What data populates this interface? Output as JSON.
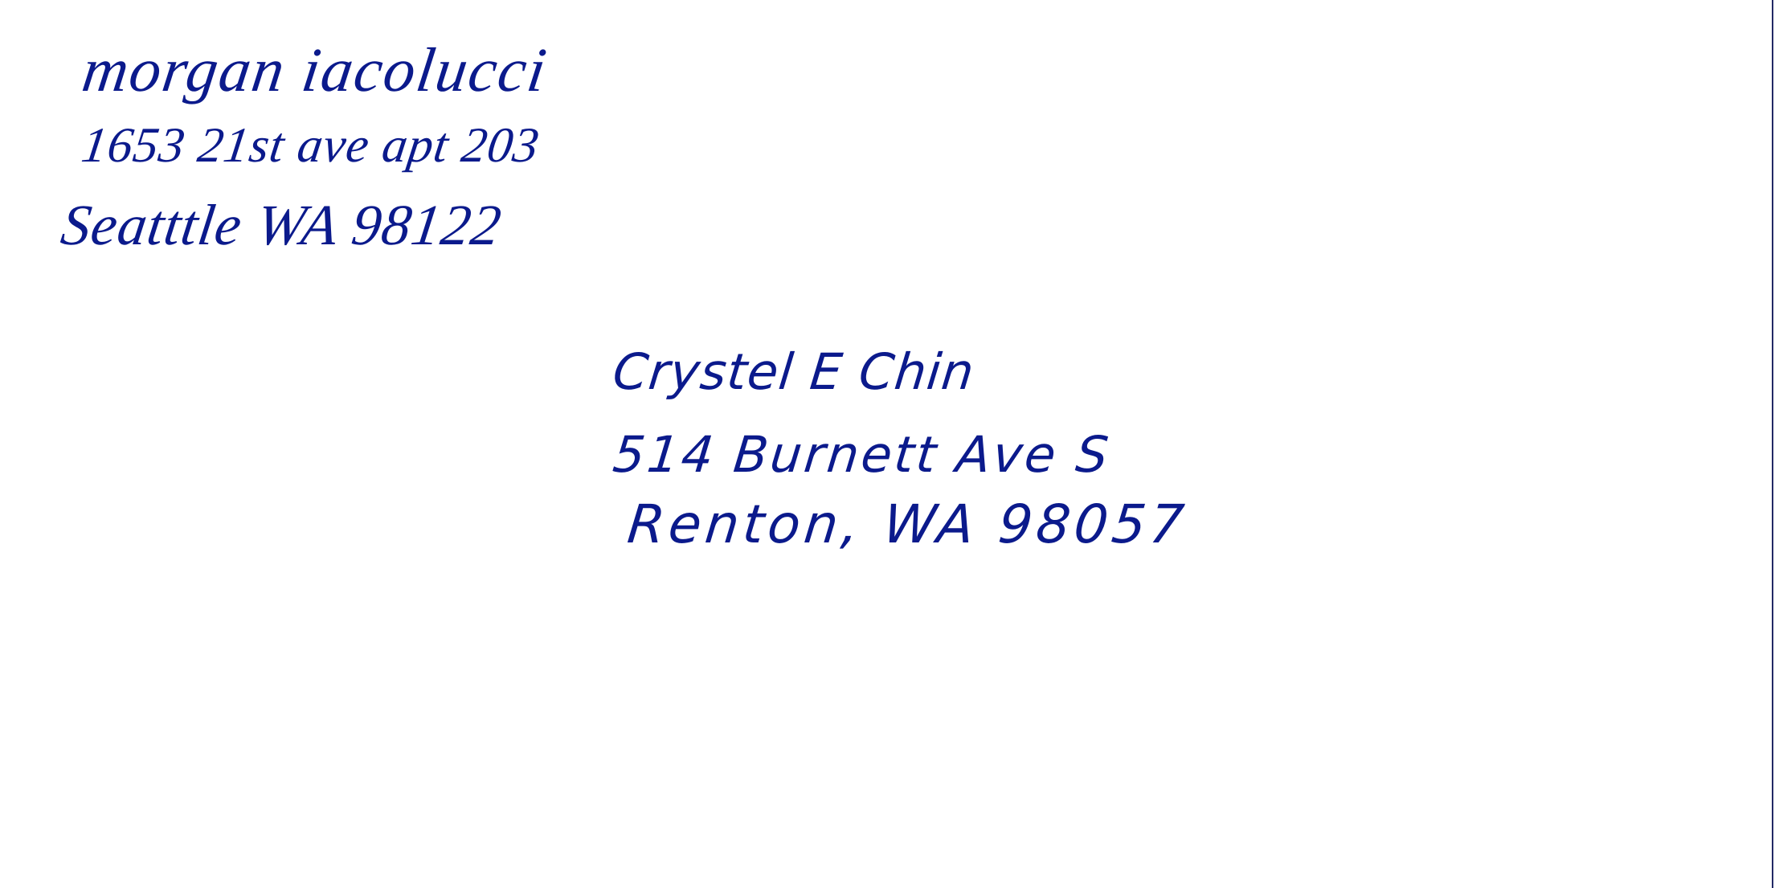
{
  "ink_color": "#0b1a8c",
  "return_address": {
    "name": "morgan iacolucci",
    "street": "1653 21st ave apt 203",
    "city_line": "Seatttle WA 98122"
  },
  "recipient_address": {
    "name": "Crystel E Chin",
    "street": "514 Burnett Ave S",
    "city_line": "Renton, WA 98057"
  }
}
